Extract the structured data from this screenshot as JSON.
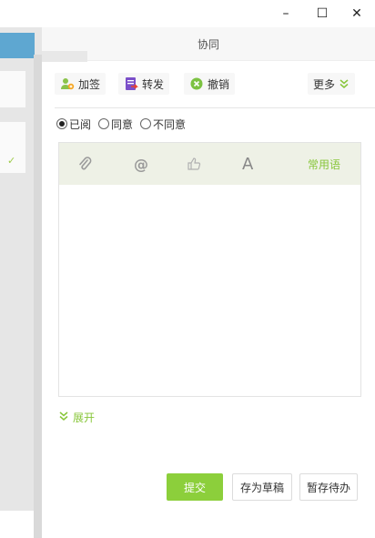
{
  "window": {
    "minimize_glyph": "–",
    "maximize_glyph": "☐",
    "close_glyph": "✕"
  },
  "dialog": {
    "title": "协同"
  },
  "toolbar": {
    "add_sign_label": "加签",
    "forward_label": "转发",
    "revoke_label": "撤销",
    "more_label": "更多"
  },
  "opinion": {
    "options": [
      "已阅",
      "同意",
      "不同意"
    ],
    "selected": "已阅"
  },
  "editor": {
    "at_glyph": "@",
    "font_glyph": "A",
    "common_phrases_label": "常用语",
    "content": ""
  },
  "expand": {
    "label": "展开"
  },
  "actions": {
    "submit_label": "提交",
    "save_draft_label": "存为草稿",
    "save_pending_label": "暂存待办"
  },
  "colors": {
    "accent_green": "#88c63a",
    "editor_bar_bg": "#eef1e6",
    "submit_bg": "#8ccf3b"
  },
  "icons": {
    "add_sign": "person-add-icon",
    "forward": "forward-doc-icon",
    "revoke": "cancel-icon",
    "more": "double-chevron-down-icon",
    "attach": "paperclip-icon",
    "mention": "at-icon",
    "like": "thumb-icon",
    "font": "font-icon",
    "expand": "double-chevron-down-icon"
  }
}
